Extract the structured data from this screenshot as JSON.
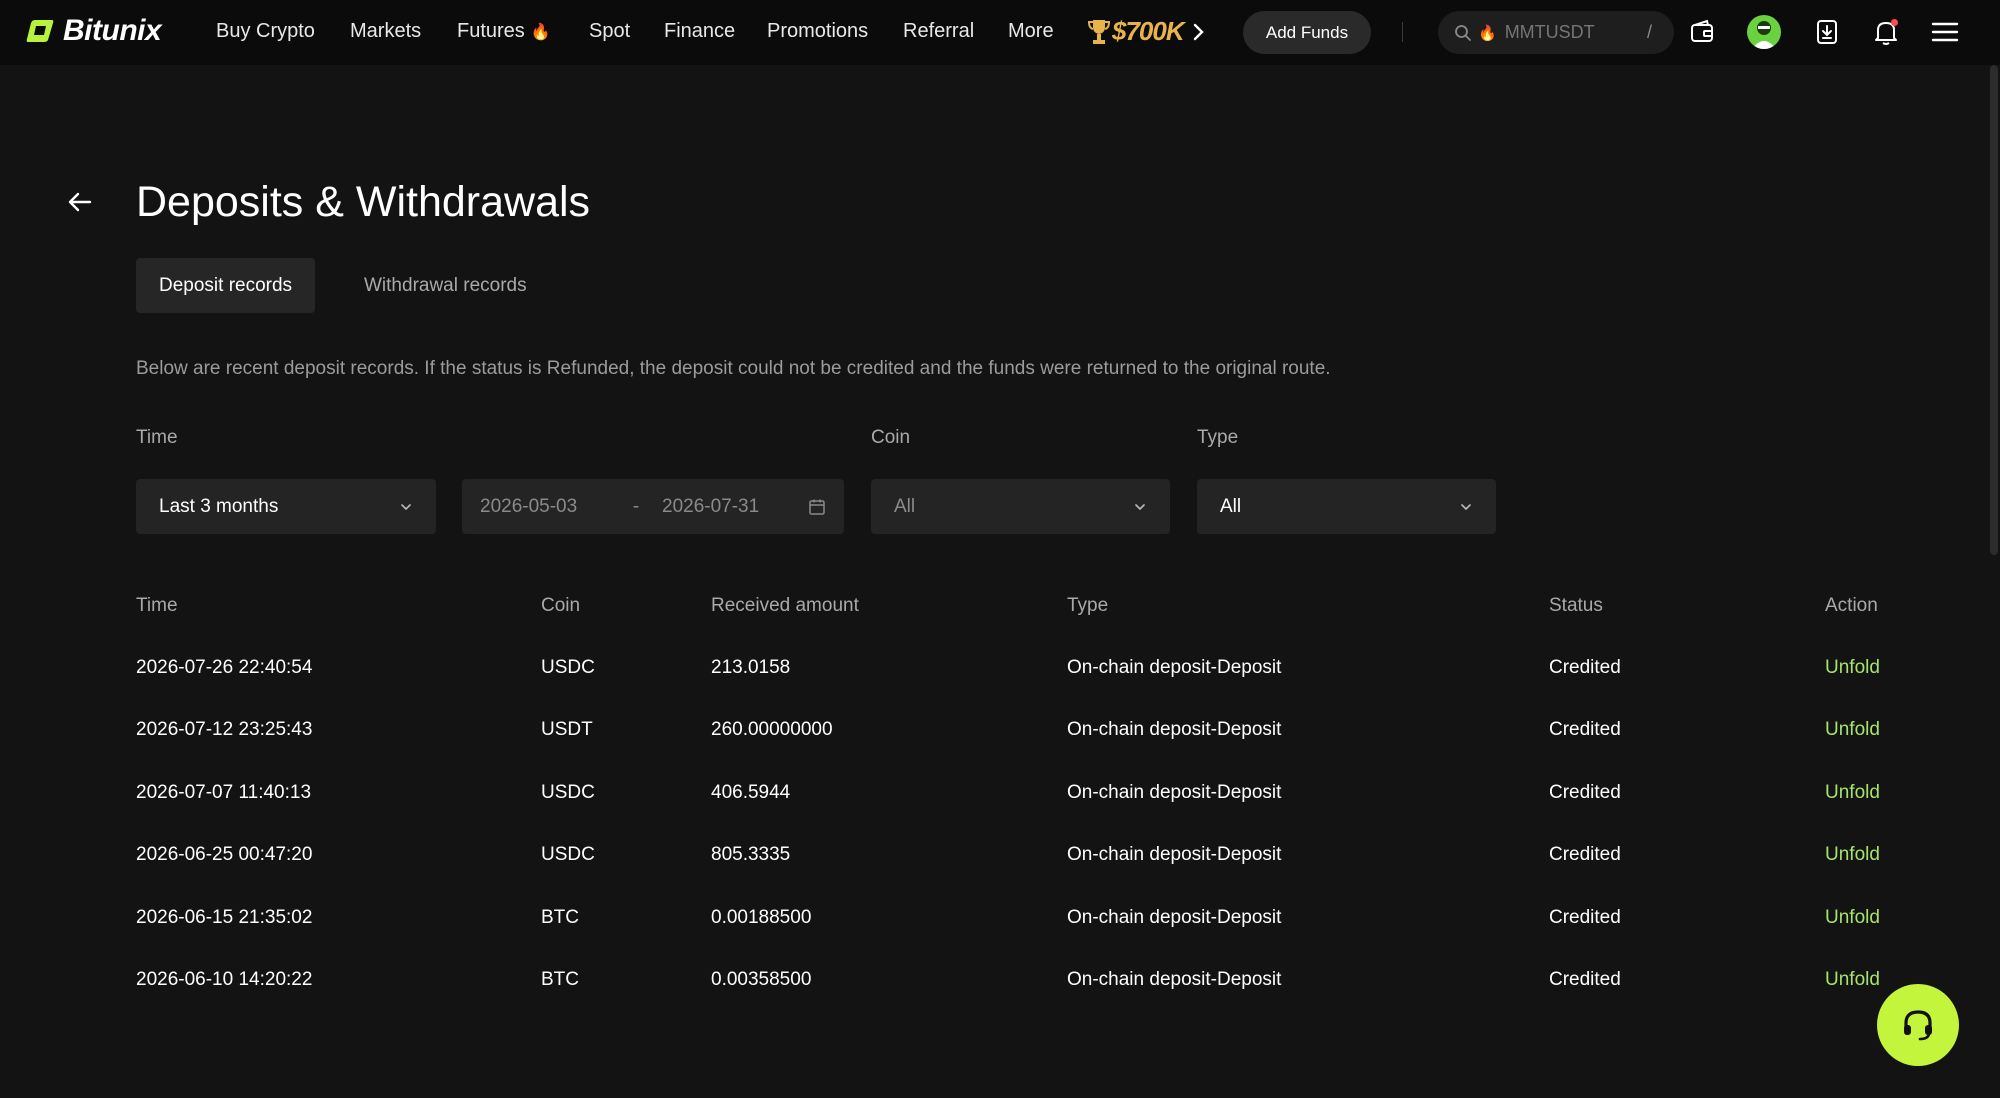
{
  "brand": {
    "name": "Bitunix",
    "accent": "#b9f23b",
    "link_color": "#a6e36a"
  },
  "nav": {
    "items": [
      "Buy Crypto",
      "Markets",
      "Futures",
      "Spot",
      "Finance",
      "Promotions",
      "Referral",
      "More"
    ],
    "futures_badge_icon": "fire-icon",
    "promo_badge": "$700K",
    "add_funds": "Add Funds",
    "search_placeholder": "MMTUSDT",
    "search_shortcut": "/"
  },
  "page": {
    "title": "Deposits & Withdrawals",
    "tabs": [
      {
        "label": "Deposit records",
        "active": true
      },
      {
        "label": "Withdrawal records",
        "active": false
      }
    ],
    "notice": "Below are recent deposit records. If the status is Refunded, the deposit could not be credited and the funds were returned to the original route."
  },
  "filters": {
    "time_label": "Time",
    "time_value": "Last 3 months",
    "date_start": "2026-05-03",
    "date_sep": "-",
    "date_end": "2026-07-31",
    "coin_label": "Coin",
    "coin_value": "All",
    "type_label": "Type",
    "type_value": "All"
  },
  "table": {
    "headers": [
      "Time",
      "Coin",
      "Received amount",
      "Type",
      "Status",
      "Action"
    ],
    "rows": [
      {
        "time": "2026-07-26 22:40:54",
        "coin": "USDC",
        "amount": "213.0158",
        "type": "On-chain deposit-Deposit",
        "status": "Credited",
        "action": "Unfold"
      },
      {
        "time": "2026-07-12 23:25:43",
        "coin": "USDT",
        "amount": "260.00000000",
        "type": "On-chain deposit-Deposit",
        "status": "Credited",
        "action": "Unfold"
      },
      {
        "time": "2026-07-07 11:40:13",
        "coin": "USDC",
        "amount": "406.5944",
        "type": "On-chain deposit-Deposit",
        "status": "Credited",
        "action": "Unfold"
      },
      {
        "time": "2026-06-25 00:47:20",
        "coin": "USDC",
        "amount": "805.3335",
        "type": "On-chain deposit-Deposit",
        "status": "Credited",
        "action": "Unfold"
      },
      {
        "time": "2026-06-15 21:35:02",
        "coin": "BTC",
        "amount": "0.00188500",
        "type": "On-chain deposit-Deposit",
        "status": "Credited",
        "action": "Unfold"
      },
      {
        "time": "2026-06-10 14:20:22",
        "coin": "BTC",
        "amount": "0.00358500",
        "type": "On-chain deposit-Deposit",
        "status": "Credited",
        "action": "Unfold"
      }
    ]
  }
}
